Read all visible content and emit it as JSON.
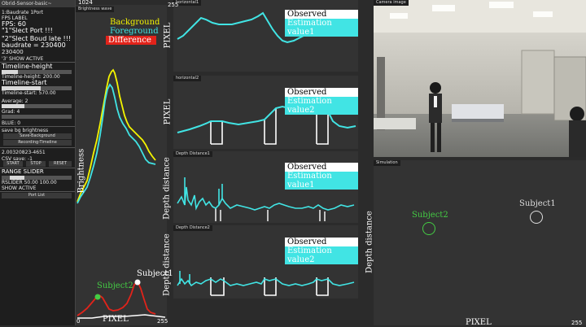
{
  "control_panel": {
    "title": "Obrid-Sensor-basic~",
    "lines": [
      "1:Baudrate 1Port",
      "FPS LABEL",
      "FPS: 60",
      "\"1\"Slect Port !!!",
      "\"2\"Slect Boud late !!!",
      "baudrate = 230400",
      "230400",
      "'3' SHOW ACTIVE",
      "Timeline-height",
      "Timeline-height: 200.00",
      "Timeline-start",
      "Timeline-start: 570.00",
      "Average: 2",
      "Grad: 4",
      "BLUE: 0",
      "save bg brightness",
      "Save-Background",
      "Recording-Timeline",
      "2.00320823-4651",
      "CSV save: -1",
      "RANGE SLIDER",
      "RSLIDER 50.00 100.00",
      "SHOW ACTIVE",
      "Port List"
    ],
    "buttons": {
      "start": "START",
      "stop": "STOP",
      "reset": "RESET"
    },
    "colors": {
      "bg": "#1e1e1e",
      "bar": "#d8d8d8"
    }
  },
  "brightness_panel": {
    "tab": "Brightness wave",
    "top_value": "1024",
    "ylabel": "Brightness",
    "xlabel": "PIXEL",
    "x_min": "0",
    "x_max": "255",
    "legend": {
      "background": "Background",
      "foreground": "Foreground",
      "difference": "Difference"
    },
    "subjects": {
      "s2": "Subject2",
      "s1": "Subject1"
    },
    "colors": {
      "background": "#f4f400",
      "foreground": "#41e4e4",
      "difference": "#e2231a"
    }
  },
  "horizontal1": {
    "tab": "horizontal1",
    "top_value": "255",
    "ylabel": "PIXEL",
    "legend": {
      "observed": "Observed value1",
      "estimation": "Estimation value1"
    }
  },
  "horizontal2": {
    "tab": "horizontal2",
    "ylabel": "PIXEL",
    "legend": {
      "observed": "Observed value2",
      "estimation": "Estimation value2"
    }
  },
  "depth1": {
    "tab": "Depth Distance1",
    "ylabel": "Depth distance",
    "legend": {
      "observed": "Observed value1",
      "estimation": "Estimation value1"
    }
  },
  "depth2": {
    "tab": "Depth Distance2",
    "ylabel": "Depth distance",
    "legend": {
      "observed": "Observed value2",
      "estimation": "Estimation value2"
    }
  },
  "camera": {
    "tab": "Camera image"
  },
  "simulation": {
    "tab": "Simulation",
    "ylabel": "Depth distance",
    "xlabel": "PIXEL",
    "x_max": "255",
    "subjects": {
      "s2": "Subject2",
      "s1": "Subject1"
    },
    "colors": {
      "s2": "#44cc44",
      "s1": "#dddddd"
    }
  }
}
